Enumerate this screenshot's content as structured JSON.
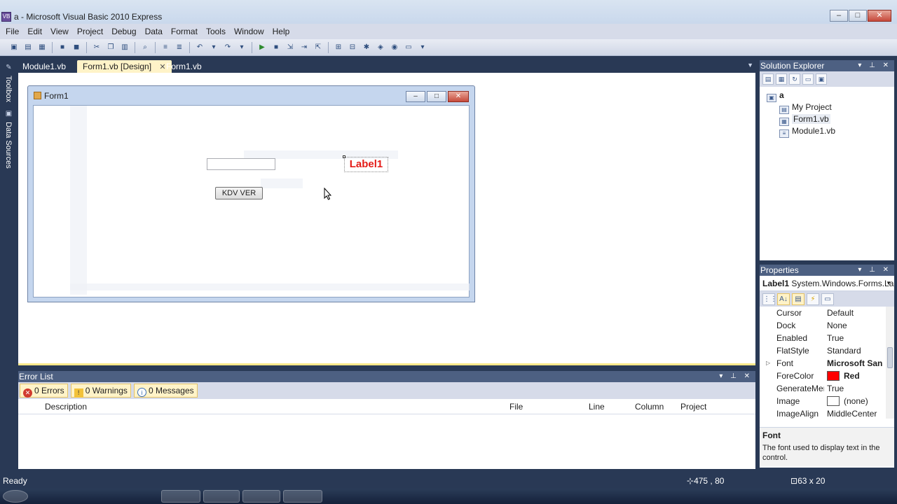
{
  "window": {
    "title": "a - Microsoft Visual Basic 2010 Express",
    "controls": [
      "–",
      "□",
      "✕"
    ]
  },
  "menu": [
    "File",
    "Edit",
    "View",
    "Project",
    "Debug",
    "Data",
    "Format",
    "Tools",
    "Window",
    "Help"
  ],
  "side_tabs": [
    "Toolbox",
    "Data Sources"
  ],
  "doc_tabs": [
    {
      "label": "Module1.vb"
    },
    {
      "label": "Form1.vb [Design]",
      "close": "✕"
    },
    {
      "label": "Form1.vb"
    }
  ],
  "form": {
    "title": "Form1",
    "button_label": "KDV VER",
    "label_text": "Label1",
    "label_color": "#e41b17"
  },
  "error_list": {
    "title": "Error List",
    "filters": [
      "0 Errors",
      "0 Warnings",
      "0 Messages"
    ],
    "columns": [
      "Description",
      "File",
      "Line",
      "Column",
      "Project"
    ]
  },
  "solution_explorer": {
    "title": "Solution Explorer",
    "items": [
      {
        "label": "a",
        "icon": "solution-icon"
      },
      {
        "label": "My Project",
        "icon": "project-icon"
      },
      {
        "label": "Form1.vb",
        "icon": "form-icon"
      },
      {
        "label": "Module1.vb",
        "icon": "module-icon"
      }
    ]
  },
  "properties": {
    "title": "Properties",
    "object_name": "Label1",
    "object_type": "System.Windows.Forms.La",
    "rows": [
      {
        "name": "Cursor",
        "value": "Default"
      },
      {
        "name": "Dock",
        "value": "None"
      },
      {
        "name": "Enabled",
        "value": "True"
      },
      {
        "name": "FlatStyle",
        "value": "Standard"
      },
      {
        "name": "Font",
        "value": "Microsoft Sans"
      },
      {
        "name": "ForeColor",
        "value": "Red"
      },
      {
        "name": "GenerateMen",
        "value": "True"
      },
      {
        "name": "Image",
        "value": "(none)"
      },
      {
        "name": "ImageAlign",
        "value": "MiddleCenter"
      }
    ],
    "forecolor_swatch": "#ff0000",
    "description_title": "Font",
    "description_text": "The font used to display text in the control."
  },
  "status": {
    "ready": "Ready",
    "position": "475 , 80",
    "size": "63 x 20"
  },
  "colors": {
    "chrome": "#293955",
    "active_tab": "#fff3c8",
    "panel_header": "#4d6082"
  }
}
